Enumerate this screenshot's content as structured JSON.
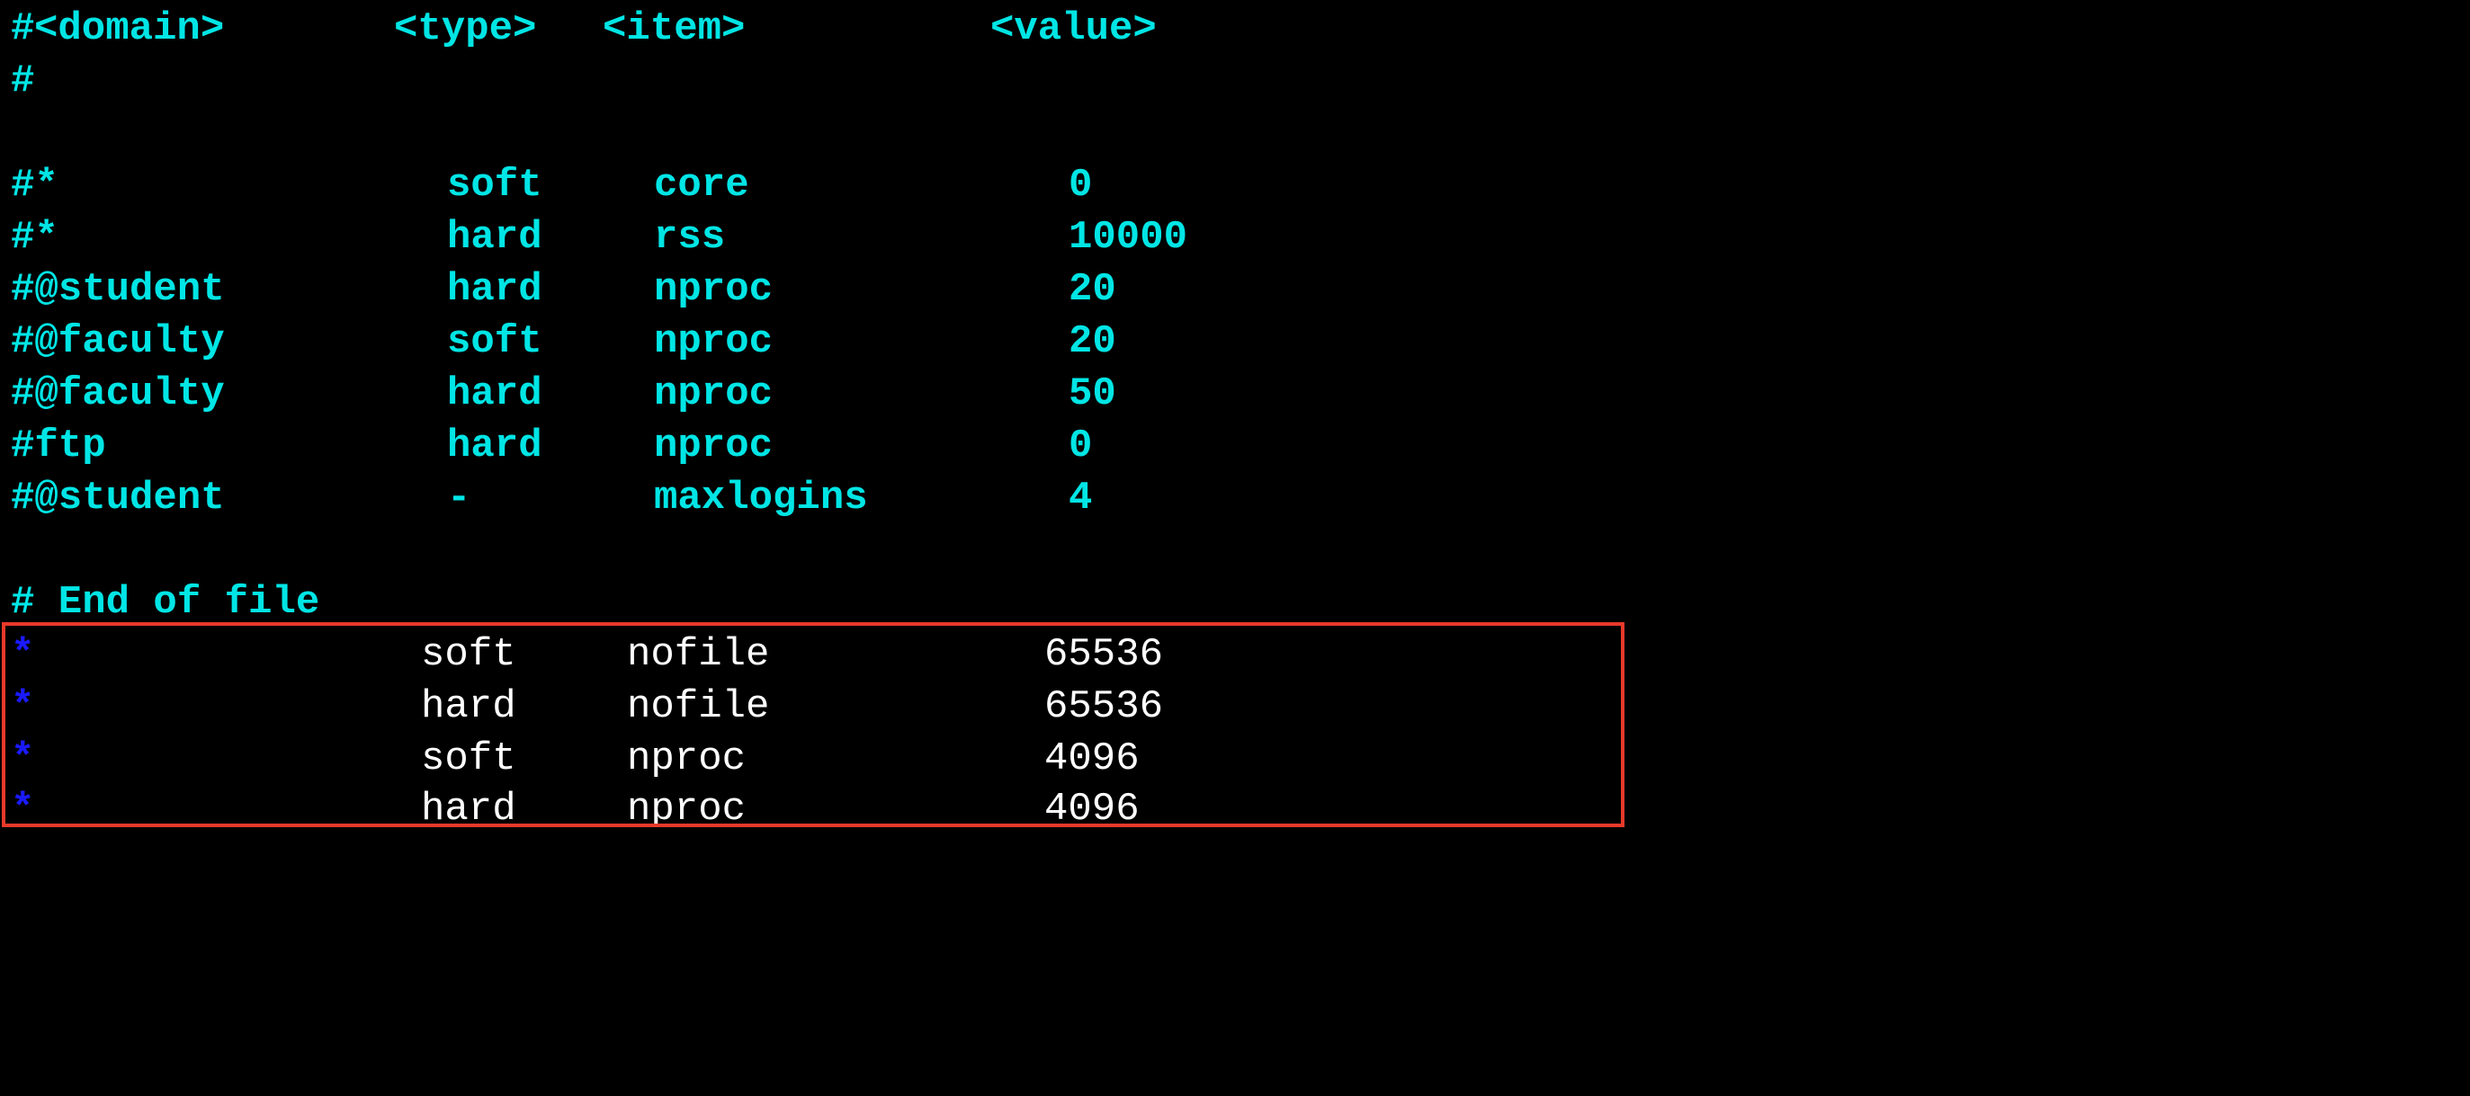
{
  "header": {
    "hash": "#",
    "domain": "<domain>",
    "type": "<type>",
    "item": "<item>",
    "value": "<value>"
  },
  "blank_hash": "#",
  "examples": [
    {
      "domain": "#*",
      "type": "soft",
      "item": "core",
      "value": "0"
    },
    {
      "domain": "#*",
      "type": "hard",
      "item": "rss",
      "value": "10000"
    },
    {
      "domain": "#@student",
      "type": "hard",
      "item": "nproc",
      "value": "20"
    },
    {
      "domain": "#@faculty",
      "type": "soft",
      "item": "nproc",
      "value": "20"
    },
    {
      "domain": "#@faculty",
      "type": "hard",
      "item": "nproc",
      "value": "50"
    },
    {
      "domain": "#ftp",
      "type": "hard",
      "item": "nproc",
      "value": "0"
    },
    {
      "domain": "#@student",
      "type": "-",
      "item": "maxlogins",
      "value": "4"
    }
  ],
  "end_of_file": "# End of file",
  "active_rules": [
    {
      "domain": "*",
      "type": "soft",
      "item": "nofile",
      "value": "65536"
    },
    {
      "domain": "*",
      "type": "hard",
      "item": "nofile",
      "value": "65536"
    },
    {
      "domain": "*",
      "type": "soft",
      "item": "nproc",
      "value": "4096"
    },
    {
      "domain": "*",
      "type": "hard",
      "item": "nproc",
      "value": "4096"
    }
  ],
  "colors": {
    "background": "#000000",
    "comment": "#00e5e5",
    "active_text": "#ffffff",
    "domain_star": "#1a1aff",
    "highlight_border": "#e8392a"
  }
}
